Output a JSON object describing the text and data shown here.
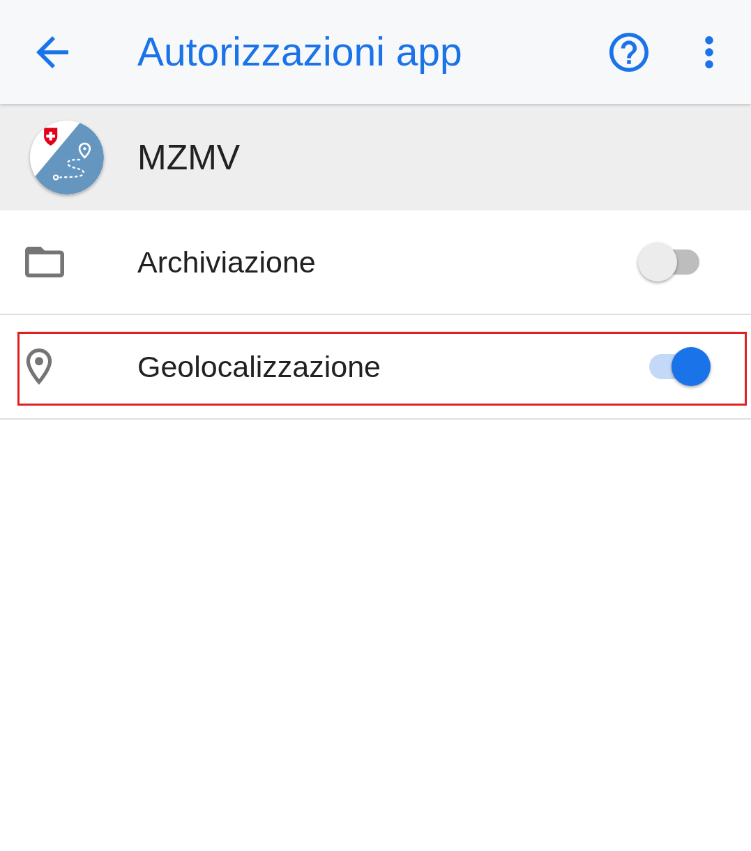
{
  "app_bar": {
    "title": "Autorizzazioni app"
  },
  "app": {
    "name": "MZMV"
  },
  "permissions": [
    {
      "kind": "storage",
      "label": "Archiviazione",
      "on": false,
      "highlighted": false
    },
    {
      "kind": "location",
      "label": "Geolocalizzazione",
      "on": true,
      "highlighted": true
    }
  ]
}
